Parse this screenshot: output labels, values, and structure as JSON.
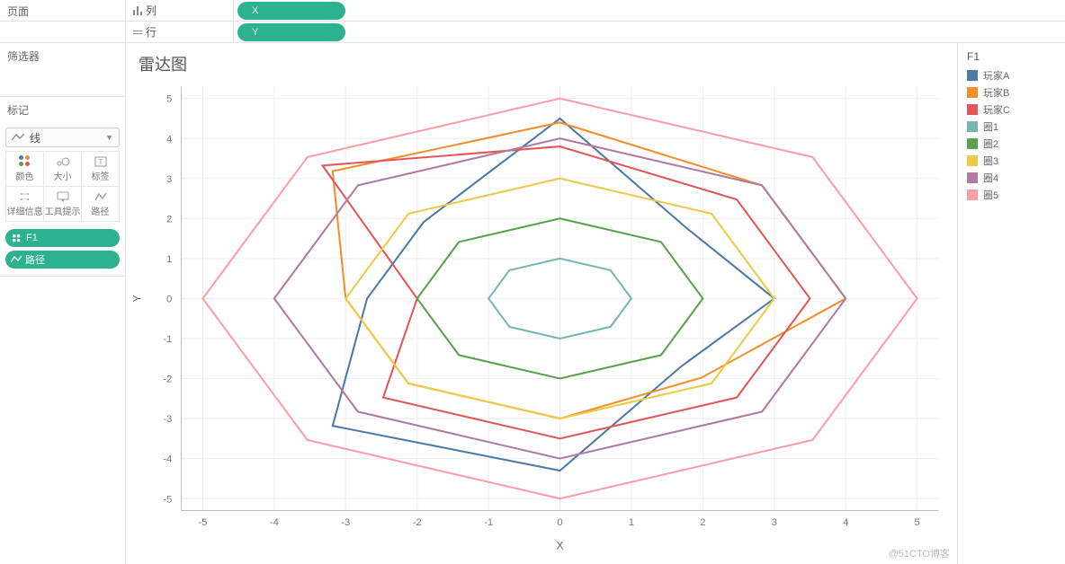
{
  "shelves": {
    "pages_label": "页面",
    "columns_label": "列",
    "columns_pill": "X",
    "rows_label": "行",
    "rows_pill": "Y"
  },
  "sidebar": {
    "filter_label": "筛选器",
    "marks_label": "标记",
    "mark_type": "线",
    "cards": [
      "颜色",
      "大小",
      "标签",
      "详细信息",
      "工具提示",
      "路径"
    ],
    "pill1": "F1",
    "pill2": "路径"
  },
  "chart": {
    "title": "雷达图",
    "xlabel": "X",
    "ylabel": "Y"
  },
  "legend": {
    "title": "F1",
    "items": [
      {
        "name": "玩家A",
        "color": "#4e79a7"
      },
      {
        "name": "玩家B",
        "color": "#f28e2b"
      },
      {
        "name": "玩家C",
        "color": "#e15759"
      },
      {
        "name": "圈1",
        "color": "#76b7b2"
      },
      {
        "name": "圈2",
        "color": "#59a14f"
      },
      {
        "name": "圈3",
        "color": "#edc948"
      },
      {
        "name": "圈4",
        "color": "#b07aa1"
      },
      {
        "name": "圈5",
        "color": "#ff9da7"
      }
    ]
  },
  "watermark": "@51CTO博客",
  "chart_data": {
    "type": "line",
    "title": "雷达图",
    "xlabel": "X",
    "ylabel": "Y",
    "xlim": [
      -5.3,
      5.3
    ],
    "ylim": [
      -5.3,
      5.3
    ],
    "xticks": [
      -5,
      -4,
      -3,
      -2,
      -1,
      0,
      1,
      2,
      3,
      4,
      5
    ],
    "yticks": [
      -5,
      -4,
      -3,
      -2,
      -1,
      0,
      1,
      2,
      3,
      4,
      5
    ],
    "note": "Radar chart drawn on XY axes. 圈1–圈5 are reference octagons at radii 1–5. 玩家A/B/C are player stat polygons on the same 8 directions (angles 90°,45°,0°,…,135°).",
    "directions_deg": [
      90,
      45,
      0,
      315,
      270,
      225,
      180,
      135
    ],
    "series": [
      {
        "name": "玩家A",
        "color": "#4e79a7",
        "radii": [
          4.5,
          2.5,
          3.0,
          2.4,
          4.3,
          4.5,
          2.7,
          2.7
        ]
      },
      {
        "name": "玩家B",
        "color": "#f28e2b",
        "radii": [
          4.4,
          4.0,
          4.0,
          2.8,
          3.0,
          3.0,
          3.0,
          4.5
        ]
      },
      {
        "name": "玩家C",
        "color": "#e15759",
        "radii": [
          3.8,
          3.5,
          3.5,
          3.5,
          3.5,
          3.5,
          2.0,
          4.7
        ]
      },
      {
        "name": "圈1",
        "color": "#76b7b2",
        "radii": [
          1,
          1,
          1,
          1,
          1,
          1,
          1,
          1
        ]
      },
      {
        "name": "圈2",
        "color": "#59a14f",
        "radii": [
          2,
          2,
          2,
          2,
          2,
          2,
          2,
          2
        ]
      },
      {
        "name": "圈3",
        "color": "#edc948",
        "radii": [
          3,
          3,
          3,
          3,
          3,
          3,
          3,
          3
        ]
      },
      {
        "name": "圈4",
        "color": "#b07aa1",
        "radii": [
          4,
          4,
          4,
          4,
          4,
          4,
          4,
          4
        ]
      },
      {
        "name": "圈5",
        "color": "#ff9da7",
        "radii": [
          5,
          5,
          5,
          5,
          5,
          5,
          5,
          5
        ]
      }
    ]
  }
}
